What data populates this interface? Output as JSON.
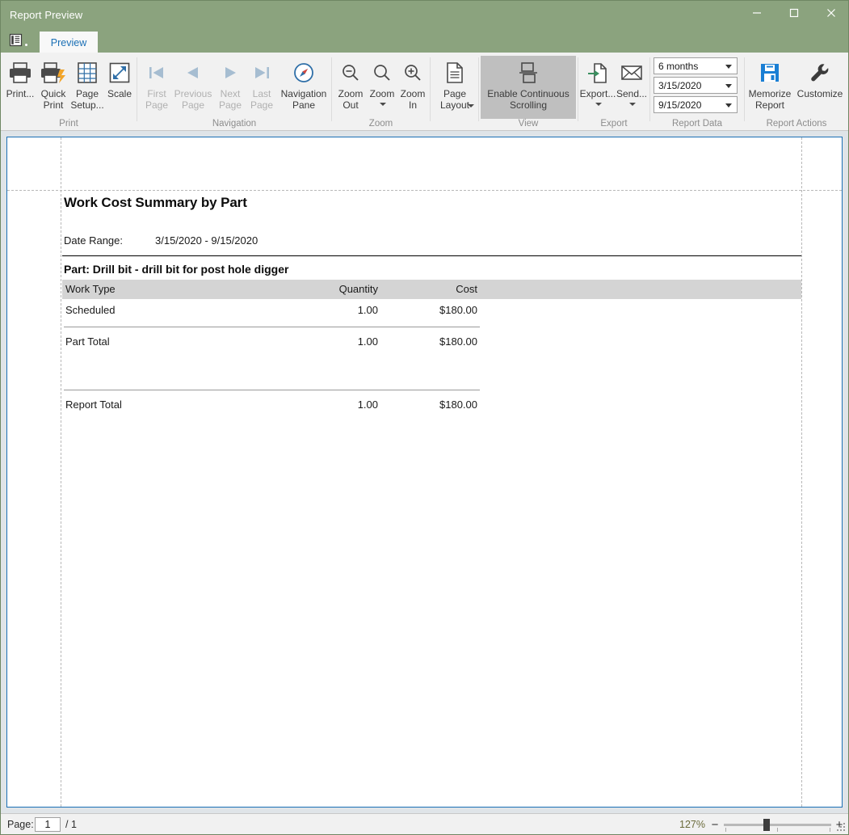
{
  "window": {
    "title": "Report Preview",
    "minimize_icon": "minimize-icon",
    "maximize_icon": "maximize-icon",
    "close_icon": "close-icon",
    "collapse_ribbon_icon": "chevron-up-icon"
  },
  "tabs": {
    "quick_access_icon": "report-menu-icon",
    "items": [
      {
        "label": "Preview",
        "active": true
      }
    ]
  },
  "ribbon": {
    "groups": [
      {
        "name": "Print",
        "label": "Print",
        "buttons": [
          {
            "name": "print-button",
            "label": "Print...",
            "icon": "printer-icon",
            "enabled": true
          },
          {
            "name": "quick-print-button",
            "label": "Quick\nPrint",
            "icon": "quick-print-icon",
            "enabled": true
          },
          {
            "name": "page-setup-button",
            "label": "Page\nSetup...",
            "icon": "page-setup-icon",
            "enabled": true
          },
          {
            "name": "scale-button",
            "label": "Scale",
            "icon": "scale-icon",
            "enabled": true
          }
        ]
      },
      {
        "name": "Navigation",
        "label": "Navigation",
        "buttons": [
          {
            "name": "first-page-button",
            "label": "First\nPage",
            "icon": "first-page-icon",
            "enabled": false
          },
          {
            "name": "previous-page-button",
            "label": "Previous\nPage",
            "icon": "previous-page-icon",
            "enabled": false
          },
          {
            "name": "next-page-button",
            "label": "Next\nPage",
            "icon": "next-page-icon",
            "enabled": false
          },
          {
            "name": "last-page-button",
            "label": "Last\nPage",
            "icon": "last-page-icon",
            "enabled": false
          },
          {
            "name": "navigation-pane-button",
            "label": "Navigation\nPane",
            "icon": "compass-icon",
            "enabled": true
          }
        ]
      },
      {
        "name": "Zoom",
        "label": "Zoom",
        "buttons": [
          {
            "name": "zoom-out-button",
            "label": "Zoom\nOut",
            "icon": "zoom-out-icon",
            "enabled": true
          },
          {
            "name": "zoom-button",
            "label": "Zoom",
            "icon": "zoom-icon",
            "enabled": true,
            "has_dropdown": true
          },
          {
            "name": "zoom-in-button",
            "label": "Zoom\nIn",
            "icon": "zoom-in-icon",
            "enabled": true
          },
          {
            "name": "page-layout-button",
            "label": "Page\nLayout",
            "icon": "page-layout-icon",
            "enabled": true,
            "has_dropdown": true
          }
        ]
      },
      {
        "name": "View",
        "label": "View",
        "buttons": [
          {
            "name": "enable-continuous-scrolling-button",
            "label": "Enable Continuous\nScrolling",
            "icon": "continuous-scrolling-icon",
            "enabled": true,
            "toggled": true
          }
        ]
      },
      {
        "name": "Export",
        "label": "Export",
        "buttons": [
          {
            "name": "export-button",
            "label": "Export...",
            "icon": "export-icon",
            "enabled": true,
            "has_dropdown": true
          },
          {
            "name": "send-button",
            "label": "Send...",
            "icon": "envelope-icon",
            "enabled": true,
            "has_dropdown": true
          }
        ]
      },
      {
        "name": "Report Data",
        "label": "Report Data",
        "combos": [
          {
            "name": "date-preset-combo",
            "value": "6 months"
          },
          {
            "name": "start-date-combo",
            "value": "3/15/2020"
          },
          {
            "name": "end-date-combo",
            "value": "9/15/2020"
          }
        ]
      },
      {
        "name": "Report Actions",
        "label": "Report Actions",
        "buttons": [
          {
            "name": "memorize-report-button",
            "label": "Memorize\nReport",
            "icon": "floppy-disk-icon",
            "enabled": true
          },
          {
            "name": "customize-button",
            "label": "Customize",
            "icon": "wrench-icon",
            "enabled": true
          }
        ]
      }
    ]
  },
  "report": {
    "title": "Work Cost Summary by Part",
    "date_range_label": "Date Range:",
    "date_range_value": "3/15/2020  -  9/15/2020",
    "part_heading": "Part: Drill bit - drill bit for post hole digger",
    "columns": [
      "Work Type",
      "Quantity",
      "Cost"
    ],
    "rows": [
      {
        "name": "Scheduled",
        "quantity": "1.00",
        "cost": "$180.00"
      }
    ],
    "part_total": {
      "name": "Part Total",
      "quantity": "1.00",
      "cost": "$180.00"
    },
    "report_total": {
      "name": "Report Total",
      "quantity": "1.00",
      "cost": "$180.00"
    }
  },
  "statusbar": {
    "page_label": "Page:",
    "page_value": "1",
    "page_total": "/ 1",
    "zoom_percent": "127%",
    "zoom_out_symbol": "−",
    "zoom_in_symbol": "+"
  }
}
